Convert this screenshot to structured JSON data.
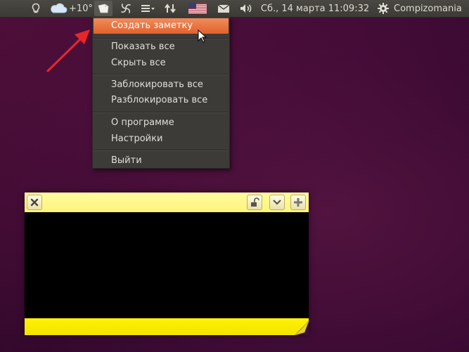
{
  "panel": {
    "indicators": [
      {
        "name": "lightbulb-icon"
      },
      {
        "name": "weather-cloud-icon"
      },
      {
        "name": "notes-indicator-icon"
      },
      {
        "name": "pinwheel-icon"
      },
      {
        "name": "menu-list-icon"
      },
      {
        "name": "network-arrows-icon"
      },
      {
        "name": "us-flag-icon"
      },
      {
        "name": "mail-icon"
      },
      {
        "name": "volume-icon"
      },
      {
        "name": "gear-icon"
      }
    ],
    "weather_temp": "+10°",
    "datetime": "Сб., 14 марта 11:09:32",
    "username": "Compizomania"
  },
  "menu": {
    "items": [
      {
        "label": "Создать заметку",
        "active": true
      },
      {
        "label": "Показать все"
      },
      {
        "label": "Скрыть все"
      },
      {
        "label": "Заблокировать все"
      },
      {
        "label": "Разблокировать все"
      },
      {
        "label": "О программе"
      },
      {
        "label": "Настройки"
      },
      {
        "label": "Выйти"
      }
    ]
  },
  "note": {
    "buttons": [
      "close-icon",
      "unlock-icon",
      "chevron-down-icon",
      "plus-icon"
    ]
  },
  "colors": {
    "wallpaper": "#400c36",
    "panel": "#3c3b37",
    "menu_highlight": "#e95420",
    "note_yellow": "#fff200",
    "annotation_arrow": "#e8262a"
  }
}
